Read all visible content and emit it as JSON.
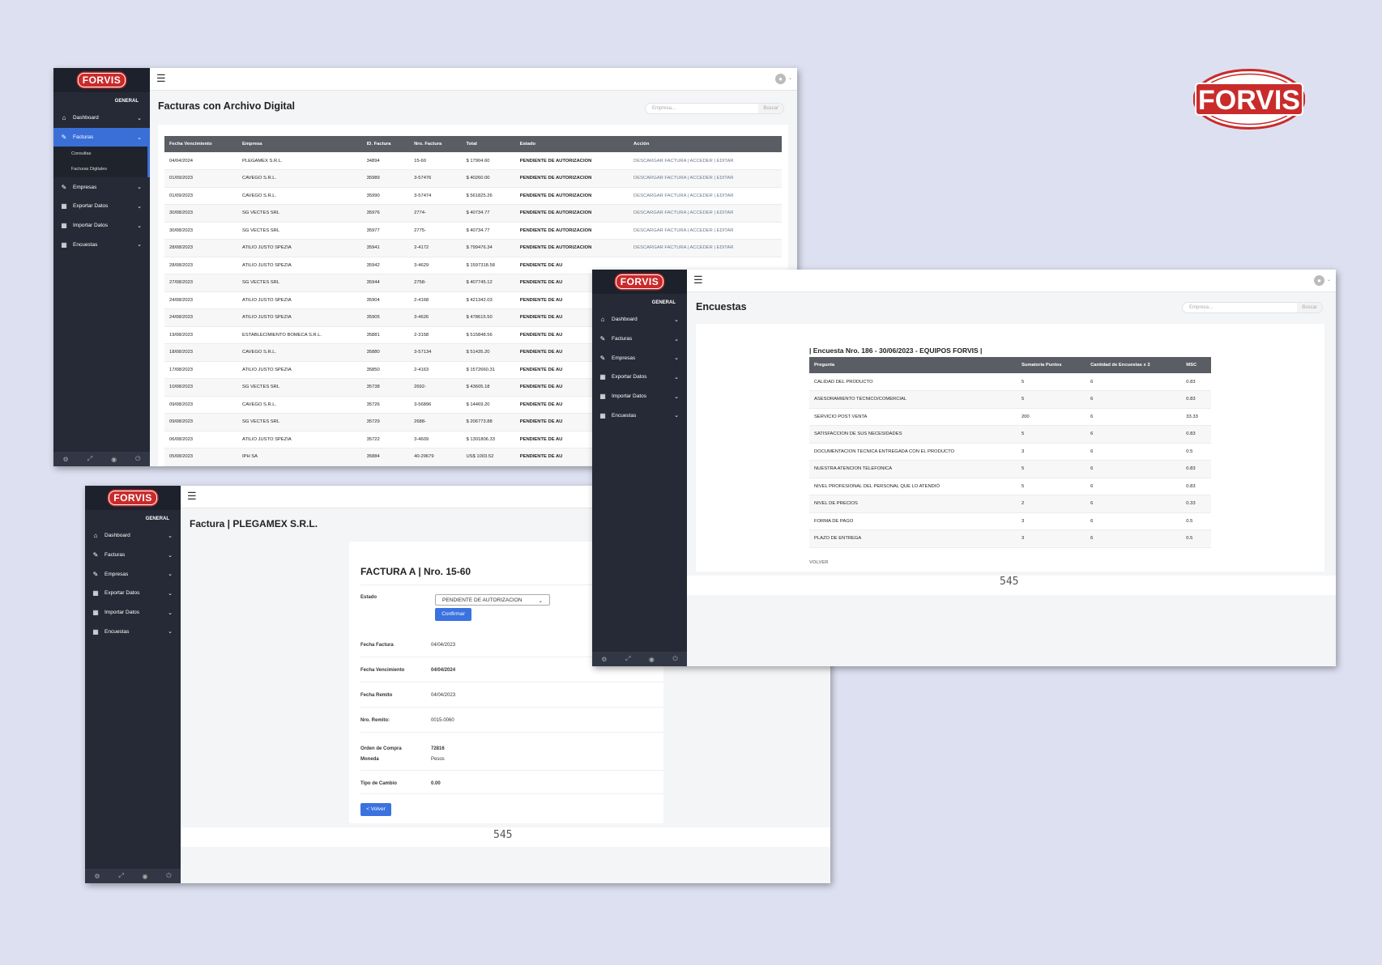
{
  "brand": {
    "logo_text": "FORVIS"
  },
  "sidebar": {
    "section": "GENERAL",
    "items": [
      {
        "label": "Dashboard",
        "icon": "home-icon"
      },
      {
        "label": "Facturas",
        "icon": "edit-icon"
      },
      {
        "label": "Empresas",
        "icon": "edit-icon"
      },
      {
        "label": "Exportar Datos",
        "icon": "table-icon"
      },
      {
        "label": "Importar Datos",
        "icon": "table-icon"
      },
      {
        "label": "Encuestas",
        "icon": "table-icon"
      }
    ],
    "submenu": [
      "Consultas",
      "Facturas Digitales"
    ]
  },
  "search": {
    "placeholder": "Empresa...",
    "button": "Buscar"
  },
  "facturas": {
    "title": "Facturas con Archivo Digital",
    "columns": [
      "Fecha Vencimiento",
      "Empresa",
      "ID. Factura",
      "Nro. Factura",
      "Total",
      "Estado",
      "Acción"
    ],
    "rows": [
      [
        "04/04/2024",
        "PLEGAMEX S.R.L.",
        "34894",
        "15-60",
        "$ 17904.60",
        "PENDIENTE DE AUTORIZACION",
        "DESCARGAR FACTURA | ACCEDER | EDITAR"
      ],
      [
        "01/09/2023",
        "CAVEGO S.R.L.",
        "35989",
        "3-57476",
        "$ 40260.00",
        "PENDIENTE DE AUTORIZACION",
        "DESCARGAR FACTURA | ACCEDER | EDITAR"
      ],
      [
        "01/09/2023",
        "CAVEGO S.R.L.",
        "35990",
        "3-57474",
        "$ 561825.26",
        "PENDIENTE DE AUTORIZACION",
        "DESCARGAR FACTURA | ACCEDER | EDITAR"
      ],
      [
        "30/08/2023",
        "SG VECTES SRL",
        "35976",
        "2774-",
        "$ 40734.77",
        "PENDIENTE DE AUTORIZACION",
        "DESCARGAR FACTURA | ACCEDER | EDITAR"
      ],
      [
        "30/08/2023",
        "SG VECTES SRL",
        "35977",
        "2775-",
        "$ 40734.77",
        "PENDIENTE DE AUTORIZACION",
        "DESCARGAR FACTURA | ACCEDER | EDITAR"
      ],
      [
        "28/08/2023",
        "ATILIO JUSTO SPEZIA",
        "35941",
        "2-4172",
        "$ 799476.34",
        "PENDIENTE DE AUTORIZACION",
        "DESCARGAR FACTURA | ACCEDER | EDITAR"
      ],
      [
        "28/08/2023",
        "ATILIO JUSTO SPEZIA",
        "35942",
        "3-4629",
        "$ 1597318.58",
        "PENDIENTE DE AU",
        ""
      ],
      [
        "27/08/2023",
        "SG VECTES SRL",
        "35944",
        "2758-",
        "$ 407745.12",
        "PENDIENTE DE AU",
        ""
      ],
      [
        "24/08/2023",
        "ATILIO JUSTO SPEZIA",
        "35904",
        "2-4168",
        "$ 421342.03",
        "PENDIENTE DE AU",
        ""
      ],
      [
        "24/08/2023",
        "ATILIO JUSTO SPEZIA",
        "35905",
        "3-4626",
        "$ 478615.50",
        "PENDIENTE DE AU",
        ""
      ],
      [
        "19/08/2023",
        "ESTABLECIMIENTO BOMECA S.R.L.",
        "35881",
        "2-3158",
        "$ 515848.56",
        "PENDIENTE DE AU",
        ""
      ],
      [
        "18/08/2023",
        "CAVEGO S.R.L.",
        "35880",
        "3-57134",
        "$ 51435.20",
        "PENDIENTE DE AU",
        ""
      ],
      [
        "17/08/2023",
        "ATILIO JUSTO SPEZIA",
        "35850",
        "2-4163",
        "$ 1572660.31",
        "PENDIENTE DE AU",
        ""
      ],
      [
        "10/08/2023",
        "SG VECTES SRL",
        "35738",
        "2692-",
        "$ 43605.18",
        "PENDIENTE DE AU",
        ""
      ],
      [
        "09/08/2023",
        "CAVEGO S.R.L.",
        "35726",
        "3-56896",
        "$ 14469.20",
        "PENDIENTE DE AU",
        ""
      ],
      [
        "09/08/2023",
        "SG VECTES SRL",
        "35729",
        "2688-",
        "$ 206773.88",
        "PENDIENTE DE AU",
        ""
      ],
      [
        "06/08/2023",
        "ATILIO JUSTO SPEZIA",
        "35722",
        "3-4609",
        "$ 1301806.33",
        "PENDIENTE DE AU",
        ""
      ],
      [
        "05/08/2023",
        "IPH SA",
        "35884",
        "40-29679",
        "US$ 1003.52",
        "PENDIENTE DE AU",
        ""
      ]
    ]
  },
  "factura": {
    "title": "Factura | PLEGAMEX S.R.L.",
    "heading": "FACTURA A | Nro. 15-60",
    "estado_label": "Estado",
    "estado_value": "PENDIENTE DE AUTORIZACION",
    "confirm": "Confirmar",
    "fields": [
      {
        "label": "Fecha Factura",
        "value": "04/04/2023",
        "bold": false
      },
      {
        "label": "Fecha Vencimiento",
        "value": "04/04/2024",
        "bold": true
      },
      {
        "label": "Fecha Remito",
        "value": "04/04/2023",
        "bold": false
      },
      {
        "label": "Nro. Remito:",
        "value": "0015-0060",
        "bold": false
      }
    ],
    "orden_label": "Orden de Compra",
    "orden_value": "72816",
    "moneda_label": "Moneda",
    "moneda_value": "Pesos",
    "cambio_label": "Tipo de Cambio",
    "cambio_value": "0.00",
    "back": "< Volver",
    "footer": "545"
  },
  "encuestas": {
    "title": "Encuestas",
    "heading": "| Encuesta Nro. 186 - 30/06/2023 - EQUIPOS FORVIS |",
    "columns": [
      "Pregunta",
      "Sumatoria Puntos",
      "Cantidad de Encuestas x 3",
      "MSC"
    ],
    "rows": [
      [
        "CALIDAD DEL PRODUCTO",
        "5",
        "6",
        "0.83"
      ],
      [
        "ASESORAMIENTO TECNICO/COMERCIAL",
        "5",
        "6",
        "0.83"
      ],
      [
        "SERVICIO POST VENTA",
        "200",
        "6",
        "33.33"
      ],
      [
        "SATISFACCION DE SUS NECESIDADES",
        "5",
        "6",
        "0.83"
      ],
      [
        "DOCUMENTACION TECNICA ENTREGADA CON EL PRODUCTO",
        "3",
        "6",
        "0.5"
      ],
      [
        "NUESTRA ATENCION TELEFONICA",
        "5",
        "6",
        "0.83"
      ],
      [
        "NIVEL PROFESIONAL DEL PERSONAL QUE LO ATENDIÓ",
        "5",
        "6",
        "0.83"
      ],
      [
        "NIVEL DE PRECIOS",
        "2",
        "6",
        "0.33"
      ],
      [
        "FORMA DE PAGO",
        "3",
        "6",
        "0.5"
      ],
      [
        "PLAZO DE ENTREGA",
        "3",
        "6",
        "0.5"
      ]
    ],
    "back": "VOLVER",
    "footer": "545"
  },
  "colors": {
    "sidebar": "#252a36",
    "accent": "#3a6fd8",
    "brand_red": "#c92b2b",
    "header": "#5a5d63"
  }
}
